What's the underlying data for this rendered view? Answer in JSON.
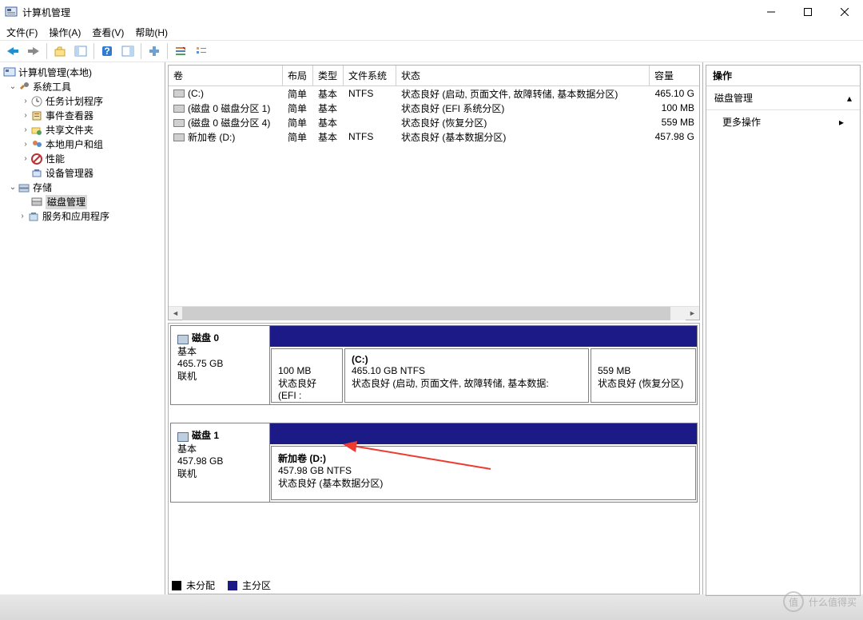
{
  "window": {
    "title": "计算机管理"
  },
  "menu": {
    "file": "文件(F)",
    "action": "操作(A)",
    "view": "查看(V)",
    "help": "帮助(H)"
  },
  "tree": {
    "root": "计算机管理(本地)",
    "sys_tools": "系统工具",
    "task_scheduler": "任务计划程序",
    "event_viewer": "事件查看器",
    "shared_folders": "共享文件夹",
    "local_users": "本地用户和组",
    "performance": "性能",
    "device_manager": "设备管理器",
    "storage": "存储",
    "disk_mgmt": "磁盘管理",
    "services_apps": "服务和应用程序"
  },
  "columns": {
    "volume": "卷",
    "layout": "布局",
    "type": "类型",
    "filesystem": "文件系统",
    "status": "状态",
    "capacity": "容量"
  },
  "volumes": [
    {
      "name": "(C:)",
      "layout": "简单",
      "type": "基本",
      "fs": "NTFS",
      "status": "状态良好 (启动, 页面文件, 故障转储, 基本数据分区)",
      "capacity": "465.10 G"
    },
    {
      "name": "(磁盘 0 磁盘分区 1)",
      "layout": "简单",
      "type": "基本",
      "fs": "",
      "status": "状态良好 (EFI 系统分区)",
      "capacity": "100 MB"
    },
    {
      "name": "(磁盘 0 磁盘分区 4)",
      "layout": "简单",
      "type": "基本",
      "fs": "",
      "status": "状态良好 (恢复分区)",
      "capacity": "559 MB"
    },
    {
      "name": "新加卷 (D:)",
      "layout": "简单",
      "type": "基本",
      "fs": "NTFS",
      "status": "状态良好 (基本数据分区)",
      "capacity": "457.98 G"
    }
  ],
  "disks": {
    "d0": {
      "title": "磁盘 0",
      "line1": "基本",
      "line2": "465.75 GB",
      "line3": "联机",
      "p1_size": "100 MB",
      "p1_status": "状态良好 (EFI :",
      "p2_name": "(C:)",
      "p2_size": "465.10 GB NTFS",
      "p2_status": "状态良好 (启动, 页面文件, 故障转储, 基本数据:",
      "p3_size": "559 MB",
      "p3_status": "状态良好 (恢复分区)"
    },
    "d1": {
      "title": "磁盘 1",
      "line1": "基本",
      "line2": "457.98 GB",
      "line3": "联机",
      "p1_name": "新加卷  (D:)",
      "p1_size": "457.98 GB NTFS",
      "p1_status": "状态良好 (基本数据分区)"
    }
  },
  "legend": {
    "unallocated": "未分配",
    "primary": "主分区"
  },
  "actions": {
    "header": "操作",
    "title": "磁盘管理",
    "more": "更多操作"
  },
  "watermark": {
    "char": "值",
    "text": "什么值得买"
  }
}
